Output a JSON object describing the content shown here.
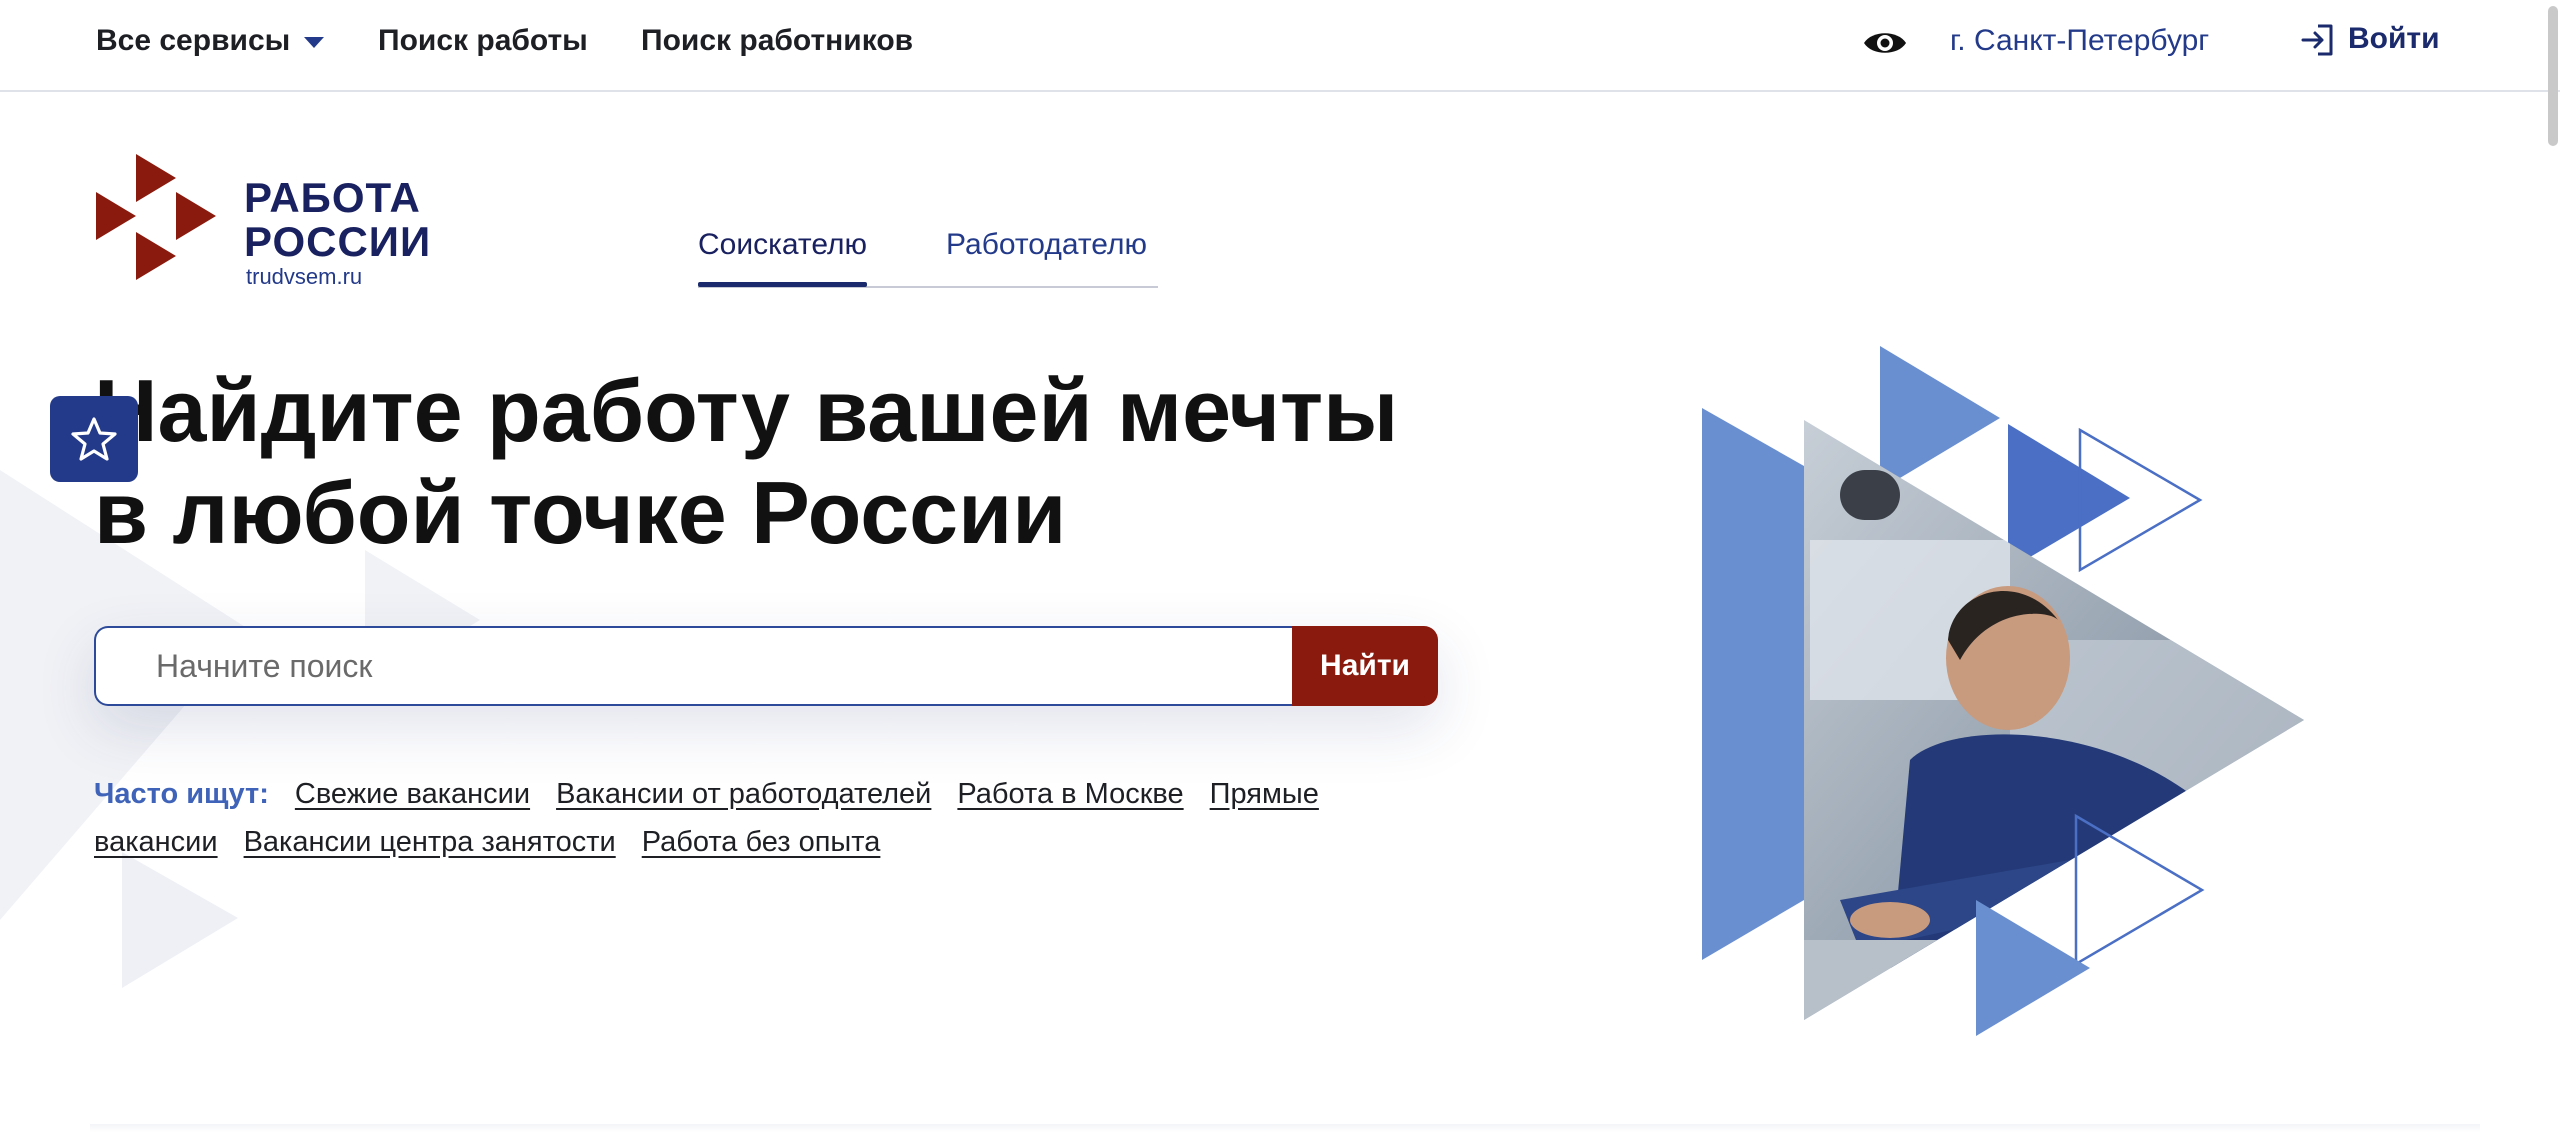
{
  "header": {
    "nav": [
      {
        "label": "Все сервисы",
        "has_dropdown": true
      },
      {
        "label": "Поиск работы"
      },
      {
        "label": "Поиск работников"
      }
    ],
    "accessibility_icon": "eye-icon",
    "city": "г. Санкт-Петербург",
    "login_label": "Войти",
    "login_icon": "login-arrow-icon"
  },
  "logo": {
    "line1": "РАБОТА",
    "line2": "РОССИИ",
    "url": "trudvsem.ru",
    "icon": "red-triangles-logo-icon"
  },
  "tabs": [
    {
      "label": "Соискателю",
      "active": true
    },
    {
      "label": "Работодателю",
      "active": false
    }
  ],
  "hero": {
    "title_line1": "Найдите работу вашей мечты",
    "title_line2": "в любой точке России",
    "favorite_icon": "star-icon"
  },
  "search": {
    "placeholder": "Начните поиск",
    "button_label": "Найти"
  },
  "popular": {
    "label": "Часто ищут:",
    "links": [
      "Свежие вакансии",
      "Вакансии от работодателей",
      "Работа в Москве",
      "Прямые вакансии",
      "Вакансии центра занятости",
      "Работа без опыта"
    ]
  },
  "colors": {
    "brand_blue": "#233a8a",
    "brand_dark": "#1a2160",
    "brand_red": "#8b1a0e",
    "accent_light_blue": "#6a8fd0",
    "link_blue": "#3f63b8"
  }
}
